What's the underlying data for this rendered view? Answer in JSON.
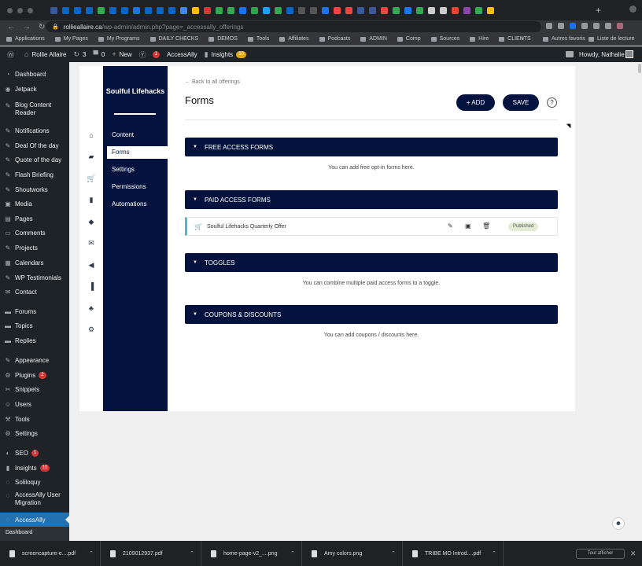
{
  "browser": {
    "url_host": "rollieallaire.ca",
    "url_path": "/wp-admin/admin.php?page=_accessally_offerings",
    "tab_colors": [
      "#3b5998",
      "#0a66c2",
      "#0a66c2",
      "#0a66c2",
      "#34a853",
      "#0a66c2",
      "#0a66c2",
      "#1a73e8",
      "#0a66c2",
      "#0a66c2",
      "#0a66c2",
      "#4285f4",
      "#fbbc05",
      "#d33",
      "#34a853",
      "#34a853",
      "#1a73e8",
      "#2ea44f",
      "#1da1f2",
      "#34a853",
      "#0a66c2",
      "#555",
      "#555",
      "#1a73e8",
      "#e44",
      "#e44",
      "#3b5998",
      "#3b5998",
      "#e44",
      "#34a853",
      "#1877f2",
      "#34a853",
      "#ccc",
      "#ccc",
      "#ea4335",
      "#8e44ad",
      "#34a853",
      "#fbbc05"
    ],
    "bookmarks": [
      "Applications",
      "My Pages",
      "My Programs",
      "DAILY CHECKS",
      "DEMOS",
      "Tools",
      "Affiliates",
      "Podcasts",
      "ADMIN",
      "Comp",
      "Sources",
      "Hire",
      "CLIENTS"
    ],
    "bookmarks_more": "»",
    "bookmarks_right": [
      "Autres favoris",
      "Liste de lecture"
    ],
    "new_tab": "+"
  },
  "adminbar": {
    "site_name": "Rollie Allaire",
    "updates_count": "3",
    "comments_count": "0",
    "new_label": "New",
    "yoast_count": "1",
    "accessally_label": "AccessAlly",
    "insights_label": "Insights",
    "insights_count": "10",
    "howdy": "Howdy, Nathalie"
  },
  "wpmenu": {
    "items": [
      {
        "label": "Dashboard",
        "icon": "◔"
      },
      {
        "label": "Jetpack",
        "icon": "◉"
      },
      {
        "label": "Blog Content Reader",
        "icon": "✎"
      },
      {
        "label": "Notifications",
        "icon": "✎"
      },
      {
        "label": "Deal Of the day",
        "icon": "✎"
      },
      {
        "label": "Quote of the day",
        "icon": "✎"
      },
      {
        "label": "Flash Briefing",
        "icon": "✎"
      },
      {
        "label": "Shoutworks",
        "icon": "✎"
      },
      {
        "label": "Media",
        "icon": "▣"
      },
      {
        "label": "Pages",
        "icon": "▤"
      },
      {
        "label": "Comments",
        "icon": "▭"
      },
      {
        "label": "Projects",
        "icon": "✎"
      },
      {
        "label": "Calendars",
        "icon": "▦"
      },
      {
        "label": "WP Testimonials",
        "icon": "✎"
      },
      {
        "label": "Contact",
        "icon": "✉"
      },
      {
        "label": "Forums",
        "icon": "▬"
      },
      {
        "label": "Topics",
        "icon": "▬"
      },
      {
        "label": "Replies",
        "icon": "▬"
      },
      {
        "label": "Appearance",
        "icon": "✎"
      },
      {
        "label": "Plugins",
        "icon": "⚙",
        "badge": "2"
      },
      {
        "label": "Snippets",
        "icon": "✂"
      },
      {
        "label": "Users",
        "icon": "☺"
      },
      {
        "label": "Tools",
        "icon": "⚒"
      },
      {
        "label": "Settings",
        "icon": "⚙"
      },
      {
        "label": "SEO",
        "icon": "◐",
        "badge": "1"
      },
      {
        "label": "Insights",
        "icon": "▮",
        "badge": "10"
      },
      {
        "label": "Soliloquy",
        "icon": "◌"
      },
      {
        "label": "AccessAlly User Migration",
        "icon": "◌"
      },
      {
        "label": "AccessAlly",
        "icon": "◌"
      }
    ],
    "submenu_first": "Dashboard"
  },
  "accessally": {
    "brand": "Soulful Lifehacks",
    "nav": [
      "Content",
      "Forms",
      "Settings",
      "Permissions",
      "Automations"
    ],
    "side_icons": [
      "home-icon",
      "lock-icon",
      "cart-icon",
      "chart-icon",
      "gift-icon",
      "mail-icon",
      "megaphone-icon",
      "book-icon",
      "group-icon",
      "gear-icon"
    ]
  },
  "main": {
    "back_link": "Back to all offerings",
    "title": "Forms",
    "add_button": "+ ADD",
    "save_button": "SAVE",
    "help": "?",
    "sections": [
      {
        "title": "FREE ACCESS FORMS",
        "empty": "You can add free opt-in forms here."
      },
      {
        "title": "PAID ACCESS FORMS",
        "empty": ""
      },
      {
        "title": "TOGGLES",
        "empty": "You can combine multiple paid access forms to a toggle."
      },
      {
        "title": "COUPONS & DISCOUNTS",
        "empty": "You can add coupons / discounts here."
      }
    ],
    "offer": {
      "name": "Soulful Lifehacks Quarterly Offer",
      "status": "Published"
    }
  },
  "downloads": {
    "items": [
      "screencapture-e....pdf",
      "2109012937.pdf",
      "home-page-v2_....png",
      "Amy colors.png",
      "TRIBE MO Introd....pdf"
    ],
    "show_all": "Tout afficher",
    "close": "✕"
  },
  "colors": {
    "navy": "#03133d",
    "wp_dark": "#1d2327",
    "wp_blue": "#2271b1",
    "accent_teal": "#53b7c4",
    "published_bg": "#e3ebd5"
  }
}
